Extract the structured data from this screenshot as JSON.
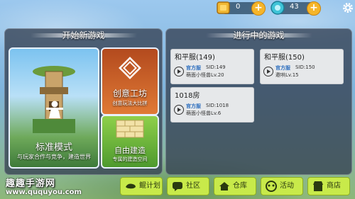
{
  "topbar": {
    "gold": {
      "value": "0",
      "icon": "gold-ticket-icon"
    },
    "gems": {
      "value": "43",
      "icon": "gem-coin-icon"
    },
    "settings_icon": "gear-icon"
  },
  "new_game": {
    "title": "开始新游戏",
    "standard": {
      "title": "标准模式",
      "subtitle": "与玩家合作与竞争，建造世界"
    },
    "workshop": {
      "title": "创意工坊",
      "subtitle": "创意玩法大比拼"
    },
    "free_build": {
      "title": "自由建造",
      "subtitle": "专属的建造空间"
    }
  },
  "ongoing": {
    "title": "进行中的游戏",
    "games": [
      {
        "name": "和平服(149)",
        "tag": "官方服",
        "sid": "SID:149",
        "owner": "萌面小怪兽Lv.20"
      },
      {
        "name": "和平服(150)",
        "tag": "官方服",
        "sid": "SID:150",
        "owner": "邀哄Lv.15"
      },
      {
        "name": "1018房",
        "tag": "官方服",
        "sid": "SID:1018",
        "owner": "萌面小怪兽Lv.6"
      }
    ]
  },
  "bottom": {
    "buttons": [
      {
        "label": "鲲计划",
        "icon": "whale-icon"
      },
      {
        "label": "社区",
        "icon": "chat-bubble-icon"
      },
      {
        "label": "仓库",
        "icon": "house-icon"
      },
      {
        "label": "活动",
        "icon": "event-icon"
      },
      {
        "label": "商店",
        "icon": "shop-icon"
      }
    ]
  },
  "watermark": {
    "line1": "趣趣手游网",
    "line2": "www.ququyou.com"
  },
  "colors": {
    "accent_green": "#c8ea4a",
    "official_tag": "#2e6fbf",
    "coin": "#f5b52a"
  }
}
